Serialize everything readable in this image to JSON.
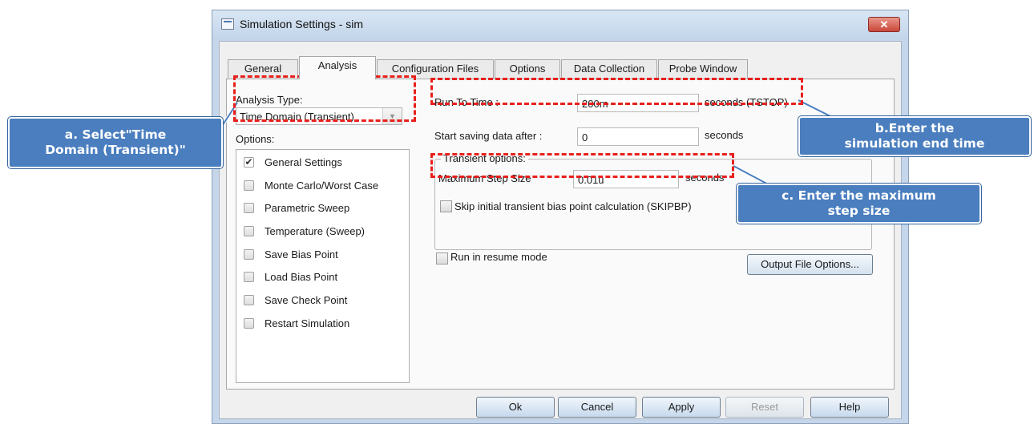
{
  "window": {
    "title": "Simulation Settings - sim",
    "close_label": "✕"
  },
  "tabs": [
    {
      "label": "General",
      "active": false
    },
    {
      "label": "Analysis",
      "active": true
    },
    {
      "label": "Configuration Files",
      "active": false
    },
    {
      "label": "Options",
      "active": false
    },
    {
      "label": "Data Collection",
      "active": false
    },
    {
      "label": "Probe Window",
      "active": false
    }
  ],
  "analysis": {
    "type_label": "Analysis Type:",
    "type_value": "Time Domain (Transient)",
    "options_label": "Options:",
    "options": [
      {
        "label": "General Settings",
        "checked": true
      },
      {
        "label": "Monte Carlo/Worst Case",
        "checked": false
      },
      {
        "label": "Parametric Sweep",
        "checked": false
      },
      {
        "label": "Temperature (Sweep)",
        "checked": false
      },
      {
        "label": "Save Bias Point",
        "checked": false
      },
      {
        "label": "Load Bias Point",
        "checked": false
      },
      {
        "label": "Save Check Point",
        "checked": false
      },
      {
        "label": "Restart Simulation",
        "checked": false
      }
    ]
  },
  "settings": {
    "run_to_time_label": "Run To Time :",
    "run_to_time_value": "200m",
    "run_to_time_unit": "seconds (TSTOP)",
    "start_saving_label": "Start saving data after :",
    "start_saving_value": "0",
    "start_saving_unit": "seconds",
    "transient_group_label": "Transient options:",
    "max_step_label": "Maximum Step Size",
    "max_step_value": "0.01u",
    "max_step_unit": "seconds",
    "skipbp_label": "Skip initial transient bias point calculation (SKIPBP)",
    "resume_label": "Run in resume mode",
    "output_file_options_label": "Output File Options..."
  },
  "buttons": {
    "ok": "Ok",
    "cancel": "Cancel",
    "apply": "Apply",
    "reset": "Reset",
    "help": "Help"
  },
  "callouts": {
    "a": "a. Select\"Time\nDomain (Transient)\"",
    "b": "b.Enter the\nsimulation end time",
    "c": "c. Enter the maximum\nstep size"
  },
  "colors": {
    "highlight": "#e8201b",
    "callout": "#4a7ebf"
  }
}
